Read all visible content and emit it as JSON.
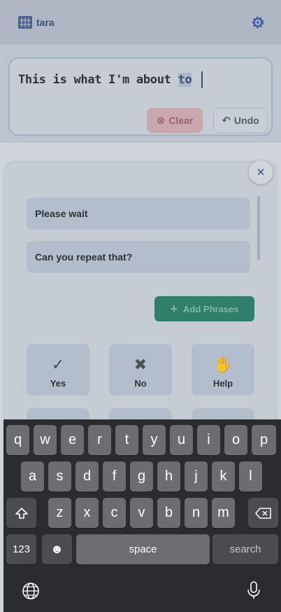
{
  "header": {
    "title": "tara",
    "logo_icon": "grid-logo-icon",
    "settings_icon": "gear-icon"
  },
  "composer": {
    "text_before": "This is what I'm about ",
    "text_highlight": "to",
    "clear_label": "Clear",
    "undo_label": "Undo"
  },
  "phrases_panel": {
    "phrases": [
      "Please wait",
      "Can you repeat that?"
    ],
    "add_label": "Add Phrases",
    "tiles": [
      {
        "label": "Yes",
        "icon": "check-icon"
      },
      {
        "label": "No",
        "icon": "x-icon"
      },
      {
        "label": "Help",
        "icon": "help-icon"
      }
    ]
  },
  "keyboard": {
    "row1": [
      "q",
      "w",
      "e",
      "r",
      "t",
      "y",
      "u",
      "i",
      "o",
      "p"
    ],
    "row2": [
      "a",
      "s",
      "d",
      "f",
      "g",
      "h",
      "j",
      "k",
      "l"
    ],
    "row3": [
      "z",
      "x",
      "c",
      "v",
      "b",
      "n",
      "m"
    ],
    "num_label": "123",
    "space_label": "space",
    "search_label": "search"
  },
  "colors": {
    "accent": "#3b4f7a",
    "add_button": "#2f7f6a",
    "clear": "#c9a8ad",
    "keyboard_bg": "#2a2c2f",
    "key": "#6b6d70"
  }
}
